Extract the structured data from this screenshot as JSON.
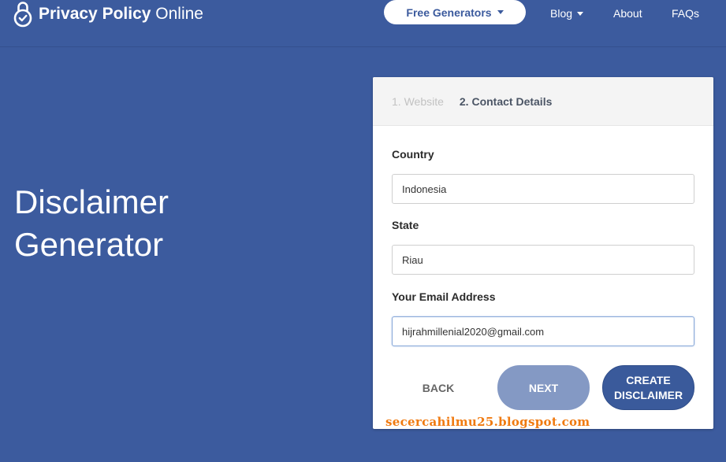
{
  "header": {
    "logo_bold": "Privacy Policy",
    "logo_light": "Online",
    "logo_icon": "padlock-check-icon",
    "nav": {
      "generators_label": "Free Generators",
      "blog_label": "Blog",
      "about_label": "About",
      "faqs_label": "FAQs"
    }
  },
  "hero": {
    "title_line1": "Disclaimer",
    "title_line2": "Generator"
  },
  "form": {
    "steps": [
      "1. Website",
      "2. Contact Details"
    ],
    "active_step": 2,
    "fields": {
      "country": {
        "label": "Country",
        "value": "Indonesia"
      },
      "state": {
        "label": "State",
        "value": "Riau"
      },
      "email": {
        "label": "Your Email Address",
        "value": "hijrahmillenial2020@gmail.com"
      }
    },
    "buttons": {
      "back": "BACK",
      "next": "NEXT",
      "create_line1": "CREATE",
      "create_line2": "DISCLAIMER"
    }
  },
  "watermark": "secercahilmu25.blogspot.com",
  "colors": {
    "background": "#3c5b9e",
    "card": "#ffffff",
    "primary_button": "#3a5a9b",
    "next_button": "#8499c4",
    "watermark": "#f07a10"
  }
}
